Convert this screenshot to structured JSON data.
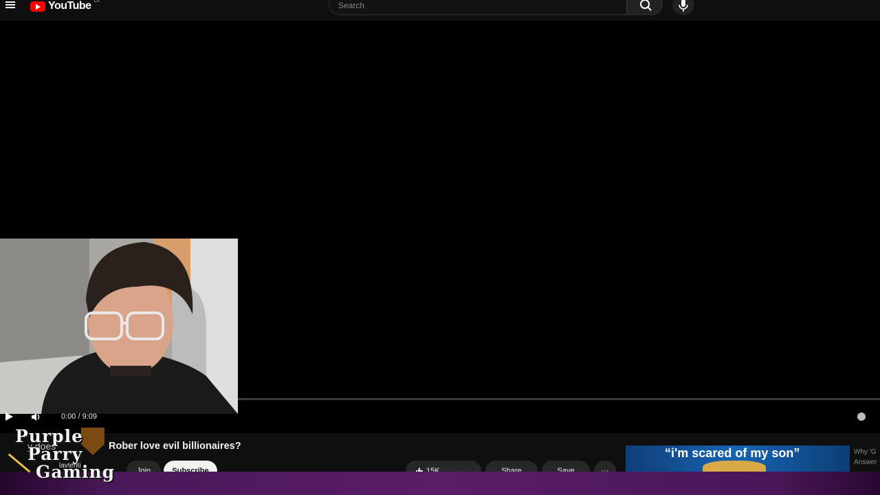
{
  "header": {
    "logo_text": "YouTube",
    "logo_superscript": "CA",
    "search_placeholder": "Search",
    "brand_color": "#ff0000"
  },
  "player": {
    "time": "0:00 / 9:09",
    "progress": 0
  },
  "video": {
    "title": "Rober love evil billionaires?",
    "title_fragment": "y does ",
    "channel_handle": "lavtenti",
    "join_label": "Join",
    "subscribe_label": "Subscribe",
    "like_label": "15K",
    "share_label": "Share",
    "save_label": "Save",
    "more_label": "···"
  },
  "overlay": {
    "line1": "Purple",
    "line2": "Parry",
    "line3": "Gaming"
  },
  "recommendation": {
    "thumbnail_text": "“i'm scared of my son”",
    "title_part1": "Why 'G",
    "title_part2": "Answer"
  }
}
